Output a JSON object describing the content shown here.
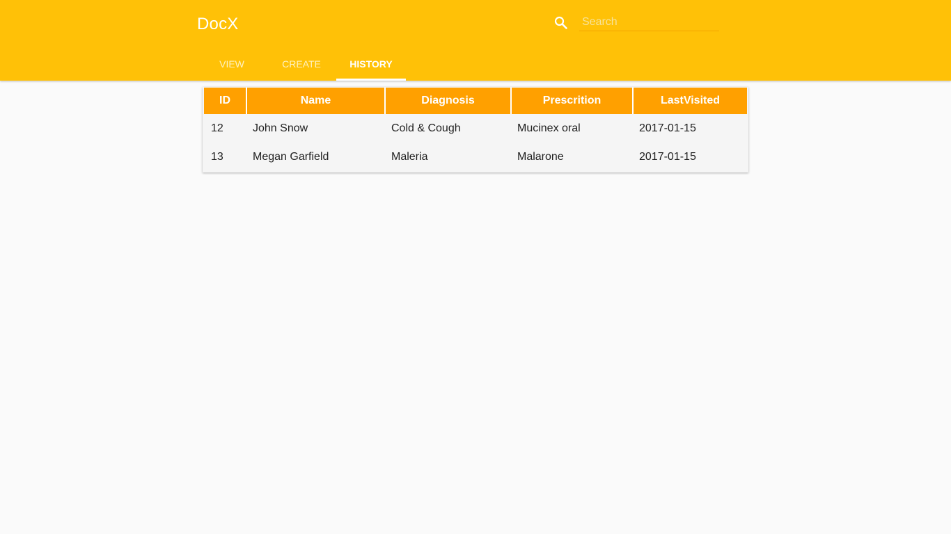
{
  "app": {
    "title": "DocX"
  },
  "search": {
    "placeholder": "Search",
    "value": ""
  },
  "tabs": [
    {
      "label": "VIEW",
      "active": false
    },
    {
      "label": "CREATE",
      "active": false
    },
    {
      "label": "HISTORY",
      "active": true
    }
  ],
  "table": {
    "columns": [
      "ID",
      "Name",
      "Diagnosis",
      "Prescrition",
      "LastVisited"
    ],
    "rows": [
      [
        "12",
        "John Snow",
        "Cold & Cough",
        "Mucinex oral",
        "2017-01-15"
      ],
      [
        "13",
        "Megan Garfield",
        "Maleria",
        "Malarone",
        "2017-01-15"
      ]
    ]
  },
  "icons": {
    "search": "search-icon"
  },
  "colors": {
    "appbar": "#ffc107",
    "header_cell": "#ffa000",
    "background": "#fafafa",
    "text": "#212121"
  }
}
